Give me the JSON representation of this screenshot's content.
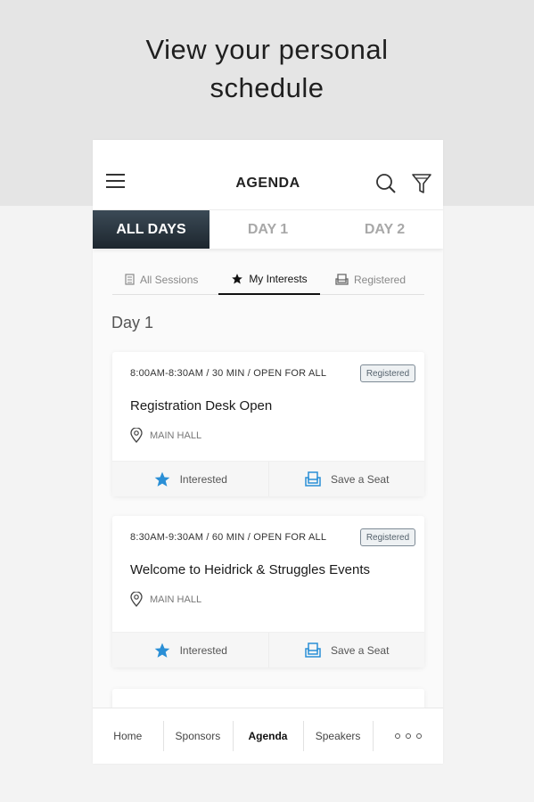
{
  "headline": [
    "View your personal",
    "schedule"
  ],
  "appbar": {
    "title": "AGENDA",
    "icons": [
      "menu-icon",
      "search-icon",
      "filter-icon"
    ]
  },
  "day_tabs": [
    {
      "label": "ALL DAYS",
      "active": true
    },
    {
      "label": "DAY 1",
      "active": false
    },
    {
      "label": "DAY 2",
      "active": false
    }
  ],
  "sub_tabs": [
    {
      "label": "All Sessions",
      "icon": "calendar-icon",
      "active": false
    },
    {
      "label": "My Interests",
      "icon": "star-icon",
      "active": true
    },
    {
      "label": "Registered",
      "icon": "seat-icon",
      "active": false
    }
  ],
  "day_label": "Day 1",
  "sessions": [
    {
      "time": "8:00AM-8:30AM / 30 MIN / OPEN FOR ALL",
      "badge": "Registered",
      "title": "Registration Desk Open",
      "location": "MAIN HALL",
      "interested_label": "Interested",
      "seat_label": "Save a Seat"
    },
    {
      "time": "8:30AM-9:30AM / 60 MIN / OPEN FOR ALL",
      "badge": "Registered",
      "title": "Welcome to Heidrick & Struggles Events",
      "location": "MAIN HALL",
      "interested_label": "Interested",
      "seat_label": "Save a Seat"
    }
  ],
  "bottom_nav": [
    {
      "label": "Home",
      "active": false
    },
    {
      "label": "Sponsors",
      "active": false
    },
    {
      "label": "Agenda",
      "active": true
    },
    {
      "label": "Speakers",
      "active": false
    }
  ],
  "colors": {
    "accent_blue": "#2a8fd6",
    "active_tab_dark": "#1d262e",
    "badge_border": "#7d8a95"
  }
}
